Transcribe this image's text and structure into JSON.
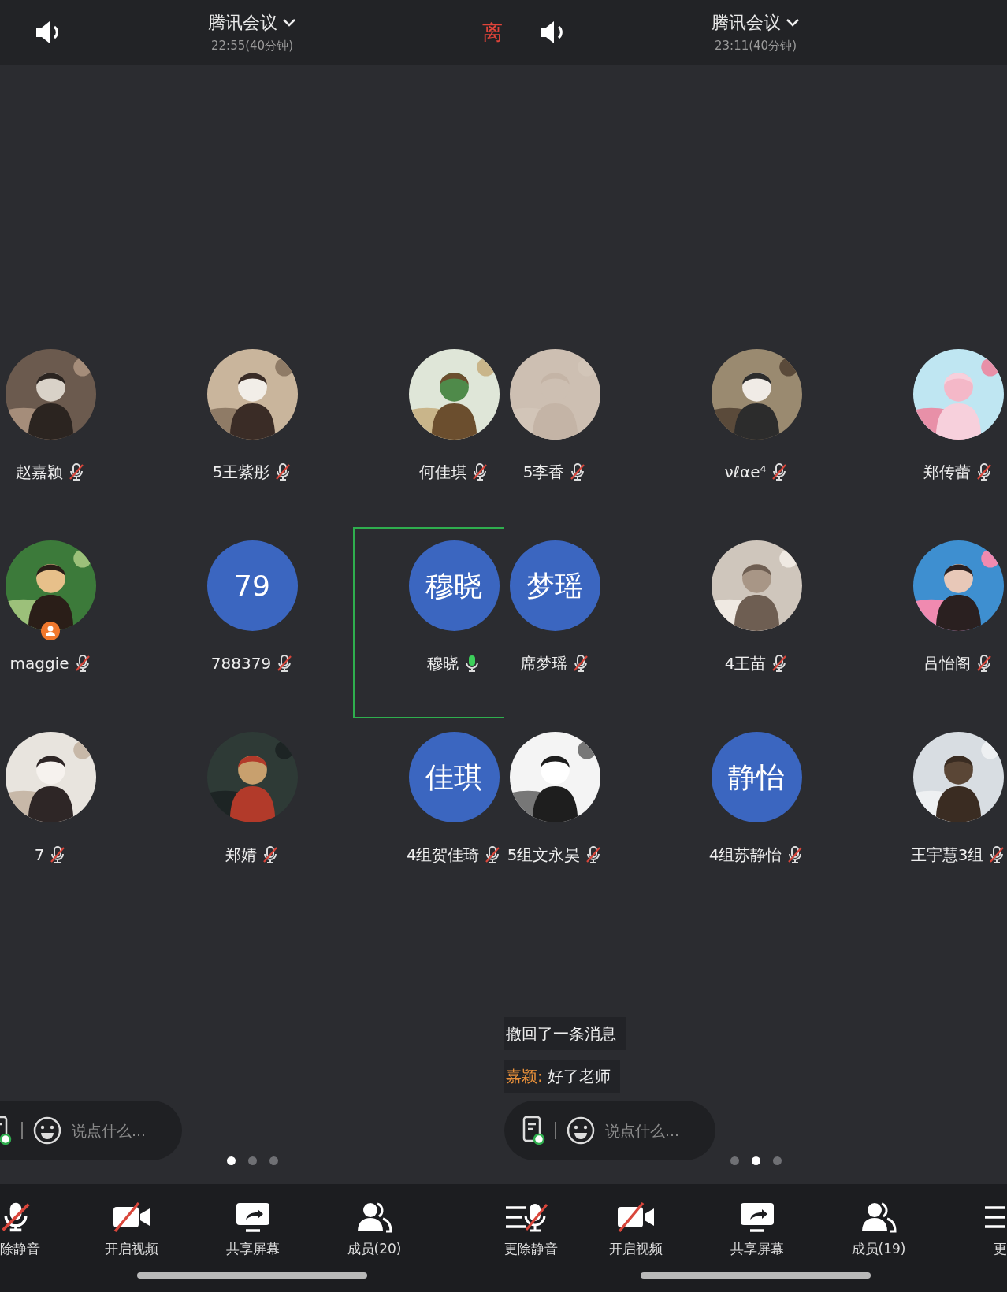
{
  "panels": [
    {
      "header": {
        "title": "腾讯会议",
        "time": "22:55(40分钟)",
        "leave": "离"
      },
      "participants": [
        {
          "name": "赵嘉颖",
          "muted": true,
          "host": false,
          "speaking": false
        },
        {
          "name": "5王紫彤",
          "muted": true,
          "host": false,
          "speaking": false
        },
        {
          "name": "何佳琪",
          "muted": true,
          "host": false,
          "speaking": false
        },
        {
          "name": "maggie",
          "muted": true,
          "host": true,
          "speaking": false
        },
        {
          "name": "788379",
          "avatar": {
            "kind": "text",
            "text": "79"
          },
          "muted": true,
          "host": false,
          "speaking": false
        },
        {
          "name": "穆晓",
          "avatar": {
            "kind": "text",
            "text": "穆晓"
          },
          "muted": false,
          "host": false,
          "speaking": true
        },
        {
          "name": "7",
          "muted": true,
          "host": false,
          "speaking": false
        },
        {
          "name": "郑婧",
          "muted": true,
          "host": false,
          "speaking": false
        },
        {
          "name": "4组贺佳琦",
          "avatar": {
            "kind": "text",
            "text": "佳琪"
          },
          "muted": true,
          "host": false,
          "speaking": false
        }
      ],
      "input": {
        "placeholder": "说点什么..."
      },
      "pages": [
        {
          "selected": true
        },
        {
          "selected": false
        },
        {
          "selected": false
        }
      ],
      "toolbar": [
        {
          "kind": "mic",
          "labels": [
            "除静音"
          ]
        },
        {
          "kind": "video",
          "labels": [
            "开启视频"
          ]
        },
        {
          "kind": "share",
          "labels": [
            "共享屏幕"
          ]
        },
        {
          "kind": "members",
          "labels": [
            "成员(20)"
          ]
        }
      ]
    },
    {
      "header": {
        "title": "腾讯会议",
        "time": "23:11(40分钟)"
      },
      "participants": [
        {
          "name": "5李香",
          "muted": true,
          "host": false,
          "speaking": false
        },
        {
          "name": "νℓαe⁴",
          "muted": true,
          "host": false,
          "speaking": false
        },
        {
          "name": "郑传蕾",
          "muted": true,
          "host": false,
          "speaking": false
        },
        {
          "name": "席梦瑶",
          "avatar": {
            "kind": "text",
            "text": "梦瑶"
          },
          "muted": true,
          "host": false,
          "speaking": false
        },
        {
          "name": "4王苗",
          "muted": true,
          "host": false,
          "speaking": false
        },
        {
          "name": "吕怡阁",
          "muted": true,
          "host": false,
          "speaking": false
        },
        {
          "name": "5组文永昊",
          "muted": true,
          "host": false,
          "speaking": false
        },
        {
          "name": "4组苏静怡",
          "avatar": {
            "kind": "text",
            "text": "静怡"
          },
          "muted": true,
          "host": false,
          "speaking": false
        },
        {
          "name": "王宇慧3组",
          "muted": true,
          "host": false,
          "speaking": false
        }
      ],
      "chat": [
        {
          "text": "撤回了一条消息"
        },
        {
          "sender": "嘉颖:",
          "text": "好了老师"
        }
      ],
      "input": {
        "placeholder": "说点什么..."
      },
      "pages": [
        {
          "selected": false
        },
        {
          "selected": true
        },
        {
          "selected": false
        }
      ],
      "toolbar": [
        {
          "kind": "menu-mic",
          "labels": [
            "更",
            "除静音"
          ]
        },
        {
          "kind": "video",
          "labels": [
            "开启视频"
          ]
        },
        {
          "kind": "share",
          "labels": [
            "共享屏幕"
          ]
        },
        {
          "kind": "members",
          "labels": [
            "成员(19)"
          ]
        },
        {
          "kind": "menu",
          "labels": [
            "更"
          ]
        }
      ]
    }
  ]
}
